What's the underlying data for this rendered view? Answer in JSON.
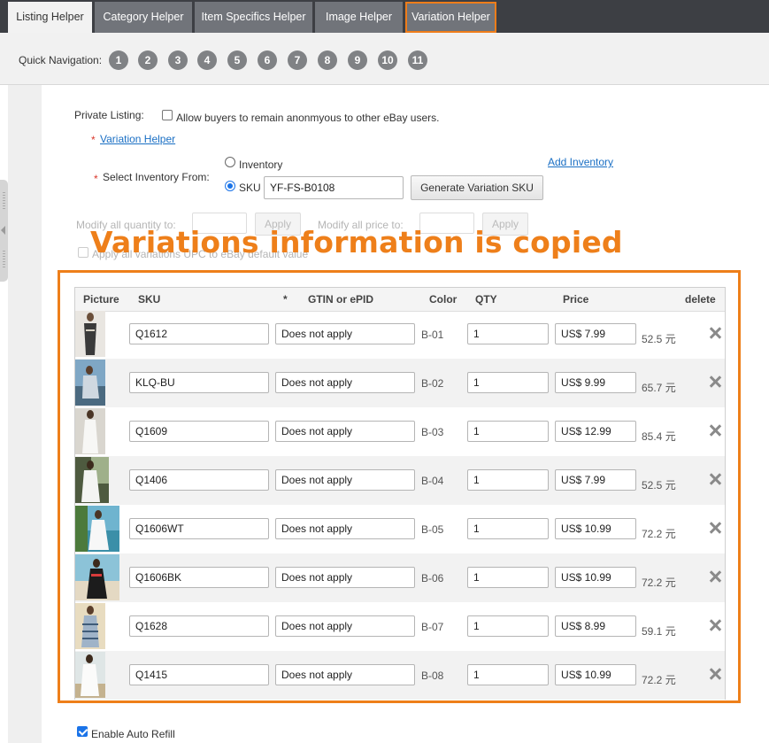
{
  "tabs": [
    {
      "label": "Listing Helper"
    },
    {
      "label": "Category Helper"
    },
    {
      "label": "Item Specifics Helper"
    },
    {
      "label": "Image Helper"
    },
    {
      "label": "Variation Helper"
    }
  ],
  "quick_nav": {
    "label": "Quick Navigation:",
    "items": [
      "1",
      "2",
      "3",
      "4",
      "5",
      "6",
      "7",
      "8",
      "9",
      "10",
      "11"
    ]
  },
  "private_listing": {
    "label": "Private Listing:",
    "checkbox_label": "Allow buyers to remain anonmyous to other eBay users."
  },
  "variation_helper_link": "Variation Helper",
  "inventory": {
    "label": "Select Inventory From:",
    "option_inventory": "Inventory",
    "option_sku": "SKU",
    "sku_value": "YF-FS-B0108",
    "generate_button": "Generate Variation SKU",
    "add_inventory_link": "Add Inventory"
  },
  "modify": {
    "quantity_label": "Modify all quantity to:",
    "price_label": "Modify all price to:",
    "apply": "Apply",
    "apply_all_label": "Apply all variations UPC to eBay default value"
  },
  "annotation": "Variations information is copied",
  "table": {
    "headers": {
      "picture": "Picture",
      "sku": "SKU",
      "req": "*",
      "gtin": "GTIN or ePID",
      "color": "Color",
      "qty": "QTY",
      "price": "Price",
      "delete": "delete"
    },
    "rows": [
      {
        "sku": "Q1612",
        "gtin": "Does not apply",
        "color": "B-01",
        "qty": "1",
        "price": "US$ 7.99",
        "cny": "52.5 元"
      },
      {
        "sku": "KLQ-BU",
        "gtin": "Does not apply",
        "color": "B-02",
        "qty": "1",
        "price": "US$ 9.99",
        "cny": "65.7 元"
      },
      {
        "sku": "Q1609",
        "gtin": "Does not apply",
        "color": "B-03",
        "qty": "1",
        "price": "US$ 12.99",
        "cny": "85.4 元"
      },
      {
        "sku": "Q1406",
        "gtin": "Does not apply",
        "color": "B-04",
        "qty": "1",
        "price": "US$ 7.99",
        "cny": "52.5 元"
      },
      {
        "sku": "Q1606WT",
        "gtin": "Does not apply",
        "color": "B-05",
        "qty": "1",
        "price": "US$ 10.99",
        "cny": "72.2 元"
      },
      {
        "sku": "Q1606BK",
        "gtin": "Does not apply",
        "color": "B-06",
        "qty": "1",
        "price": "US$ 10.99",
        "cny": "72.2 元"
      },
      {
        "sku": "Q1628",
        "gtin": "Does not apply",
        "color": "B-07",
        "qty": "1",
        "price": "US$ 8.99",
        "cny": "59.1 元"
      },
      {
        "sku": "Q1415",
        "gtin": "Does not apply",
        "color": "B-08",
        "qty": "1",
        "price": "US$ 10.99",
        "cny": "72.2 元"
      }
    ]
  },
  "enable_auto_refill": "Enable Auto Refill",
  "colors": {
    "highlight": "#ee7f1a",
    "tab_bar": "#3d3f44",
    "link": "#1a6fc4"
  }
}
